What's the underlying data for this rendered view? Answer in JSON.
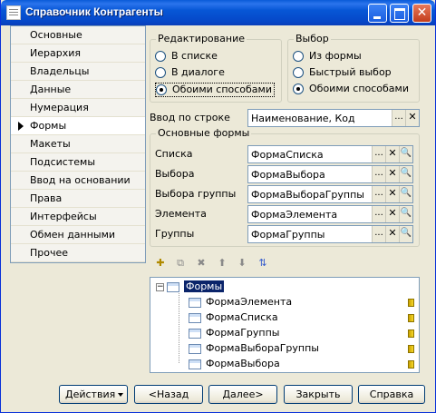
{
  "window": {
    "title": "Справочник Контрагенты"
  },
  "nav": {
    "items": [
      {
        "label": "Основные"
      },
      {
        "label": "Иерархия"
      },
      {
        "label": "Владельцы"
      },
      {
        "label": "Данные"
      },
      {
        "label": "Нумерация"
      },
      {
        "label": "Формы",
        "active": true
      },
      {
        "label": "Макеты"
      },
      {
        "label": "Подсистемы"
      },
      {
        "label": "Ввод на основании"
      },
      {
        "label": "Права"
      },
      {
        "label": "Интерфейсы"
      },
      {
        "label": "Обмен данными"
      },
      {
        "label": "Прочее"
      }
    ]
  },
  "editing": {
    "title": "Редактирование",
    "options": [
      "В списке",
      "В диалоге",
      "Обоими способами"
    ],
    "selected": 2
  },
  "selection": {
    "title": "Выбор",
    "options": [
      "Из формы",
      "Быстрый выбор",
      "Обоими способами"
    ],
    "selected": 2
  },
  "input_by_string": {
    "label": "Ввод по строке",
    "value": "Наименование, Код"
  },
  "main_forms": {
    "title": "Основные формы",
    "rows": [
      {
        "label": "Списка",
        "value": "ФормаСписка"
      },
      {
        "label": "Выбора",
        "value": "ФормаВыбора"
      },
      {
        "label": "Выбора группы",
        "value": "ФормаВыбораГруппы"
      },
      {
        "label": "Элемента",
        "value": "ФормаЭлемента"
      },
      {
        "label": "Группы",
        "value": "ФормаГруппы"
      }
    ]
  },
  "field_buttons": {
    "choose": "...",
    "clear": "✕",
    "open": "🔍"
  },
  "tree": {
    "root": "Формы",
    "root_toggle": "−",
    "children": [
      "ФормаЭлемента",
      "ФормаСписка",
      "ФормаГруппы",
      "ФормаВыбораГруппы",
      "ФормаВыбора"
    ]
  },
  "buttons": {
    "actions": "Действия",
    "back": "<Назад",
    "next": "Далее>",
    "close": "Закрыть",
    "help": "Справка"
  }
}
